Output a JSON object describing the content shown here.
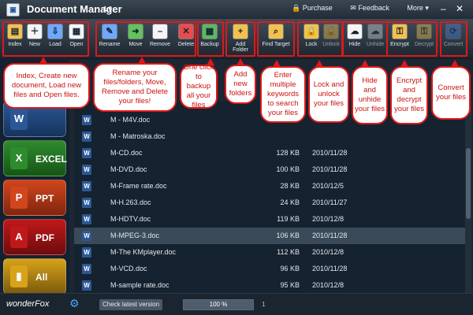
{
  "window": {
    "title": "Document Manager",
    "version": "1.0",
    "app_icon": "document-manager-icon"
  },
  "title_links": {
    "purchase": "Purchase",
    "feedback": "Feedback",
    "more": "More ▾"
  },
  "toolbar": [
    {
      "label": "Index",
      "icon": "index-icon",
      "color": "#f2c14e"
    },
    {
      "label": "New",
      "icon": "new-icon",
      "color": "#f5f5f5"
    },
    {
      "label": "Load",
      "icon": "load-icon",
      "color": "#6ea8ff"
    },
    {
      "label": "Open",
      "icon": "open-icon",
      "color": "#f5f5f5"
    },
    {
      "label": "Rename",
      "icon": "rename-icon",
      "color": "#6ea8ff"
    },
    {
      "label": "Move",
      "icon": "move-icon",
      "color": "#64c35a"
    },
    {
      "label": "Remove",
      "icon": "remove-icon",
      "color": "#f5f5f5"
    },
    {
      "label": "Delete",
      "icon": "delete-icon",
      "color": "#e84d4d"
    },
    {
      "label": "Backup",
      "icon": "backup-icon",
      "color": "#5db85c"
    },
    {
      "label": "Add Folder",
      "icon": "add-folder-icon",
      "color": "#f2c14e"
    },
    {
      "label": "Find Target",
      "icon": "find-target-icon",
      "color": "#f2c14e"
    },
    {
      "label": "Lock",
      "icon": "lock-icon",
      "color": "#f2c14e"
    },
    {
      "label": "Unlock",
      "icon": "unlock-icon",
      "color": "#f2c14e",
      "disabled": true
    },
    {
      "label": "Hide",
      "icon": "hide-icon",
      "color": "#f5f5f5"
    },
    {
      "label": "Unhide",
      "icon": "unhide-icon",
      "color": "#c7ccd1",
      "disabled": true
    },
    {
      "label": "Encrypt",
      "icon": "encrypt-icon",
      "color": "#f2c14e"
    },
    {
      "label": "Decrypt",
      "icon": "decrypt-icon",
      "color": "#f2c14e",
      "disabled": true
    },
    {
      "label": "Convert",
      "icon": "convert-icon",
      "color": "#4b7fd1",
      "disabled": true
    }
  ],
  "callouts": [
    "Index, Create new document, Load new files and Open files.",
    "Rename your files/folders, Move, Remove and Delete your files!",
    "One click to backup all your files",
    "Add new folders",
    "Enter multiple keywords to search your files",
    "Lock and unlock your files",
    "Hide and unhide your files",
    "Encrypt and decrypt your files",
    "Convert your files"
  ],
  "categories": [
    {
      "label": "",
      "icon": "word-icon",
      "color": "#2b5797"
    },
    {
      "label": "EXCEL",
      "icon": "excel-icon",
      "color": "#2e8b2e"
    },
    {
      "label": "PPT",
      "icon": "ppt-icon",
      "color": "#d1461d"
    },
    {
      "label": "PDF",
      "icon": "pdf-icon",
      "color": "#c0181a"
    },
    {
      "label": "All",
      "icon": "all-icon",
      "color": "#d8a21a"
    }
  ],
  "files": [
    {
      "name": "M - M4V.doc",
      "size": "",
      "date": "",
      "selected": false
    },
    {
      "name": "M - Matroska.doc",
      "size": "",
      "date": "",
      "selected": false
    },
    {
      "name": "M-CD.doc",
      "size": "128 KB",
      "date": "2010/11/28",
      "selected": false
    },
    {
      "name": "M-DVD.doc",
      "size": "100 KB",
      "date": "2010/11/28",
      "selected": false
    },
    {
      "name": "M-Frame rate.doc",
      "size": "28 KB",
      "date": "2010/12/5",
      "selected": false
    },
    {
      "name": "M-H.263.doc",
      "size": "24 KB",
      "date": "2010/11/27",
      "selected": false
    },
    {
      "name": "M-HDTV.doc",
      "size": "119 KB",
      "date": "2010/12/8",
      "selected": false
    },
    {
      "name": "M-MPEG-3.doc",
      "size": "106 KB",
      "date": "2010/11/28",
      "selected": true
    },
    {
      "name": "M-The KMplayer.doc",
      "size": "112 KB",
      "date": "2010/12/8",
      "selected": false
    },
    {
      "name": "M-VCD.doc",
      "size": "96 KB",
      "date": "2010/11/28",
      "selected": false
    },
    {
      "name": "M-sample rate.doc",
      "size": "95 KB",
      "date": "2010/12/8",
      "selected": false
    }
  ],
  "status": {
    "logo": "wonderFox",
    "check_label": "Check latest version",
    "progress_label": "100 %",
    "progress": 1.0,
    "page": "1"
  }
}
